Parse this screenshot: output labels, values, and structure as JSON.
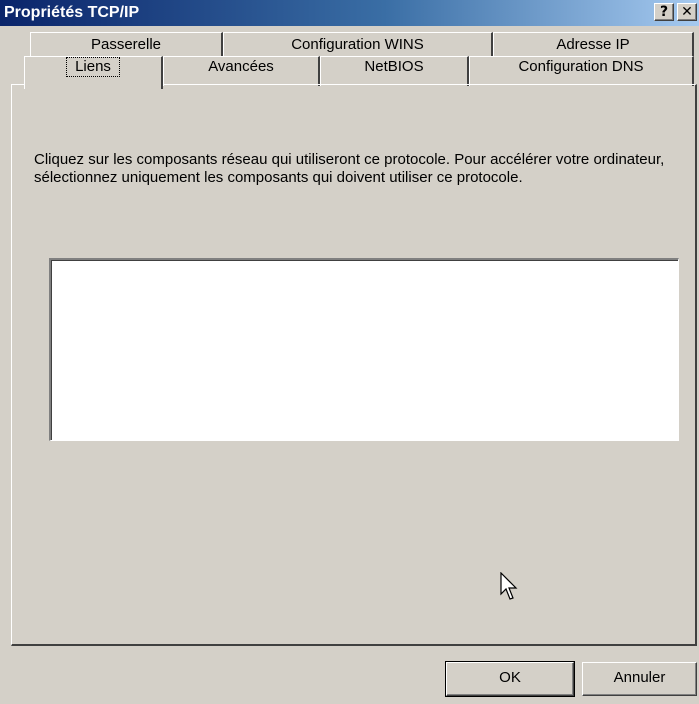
{
  "window": {
    "title": "Propriétés TCP/IP",
    "help_glyph": "?",
    "close_glyph": "✕"
  },
  "tabs": {
    "row1": [
      "Passerelle",
      "Configuration WINS",
      "Adresse IP"
    ],
    "row2": [
      "Liens",
      "Avancées",
      "NetBIOS",
      "Configuration DNS"
    ],
    "active": "Liens"
  },
  "content": {
    "description": "Cliquez sur les composants réseau qui utiliseront ce protocole. Pour accélérer votre ordinateur, sélectionnez uniquement les composants qui doivent utiliser ce protocole."
  },
  "buttons": {
    "ok": "OK",
    "cancel": "Annuler"
  },
  "colors": {
    "title_bar_start": "#0a246a",
    "title_bar_end": "#a6caf0",
    "dialog_face": "#d4d0c8"
  }
}
